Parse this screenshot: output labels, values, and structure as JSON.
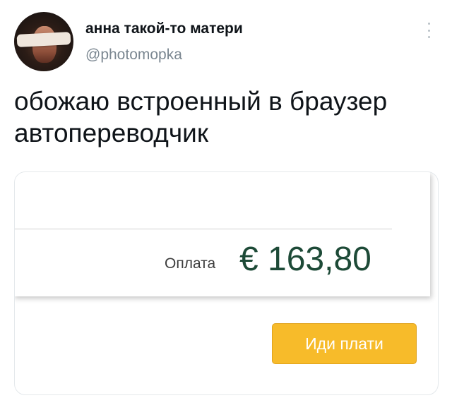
{
  "tweet": {
    "author_name": "анна такой-то матери",
    "author_handle": "@photomopka",
    "text": "обожаю встроенный в браузер автопереводчик",
    "more_icon": "more-vertical-icon",
    "avatar": "avatar-photo"
  },
  "screenshot": {
    "payment_label": "Оплата",
    "payment_amount": "€ 163,80",
    "pay_button_label": "Иди плати",
    "amount_color": "#1d4a37",
    "button_color": "#f7bb2a"
  }
}
